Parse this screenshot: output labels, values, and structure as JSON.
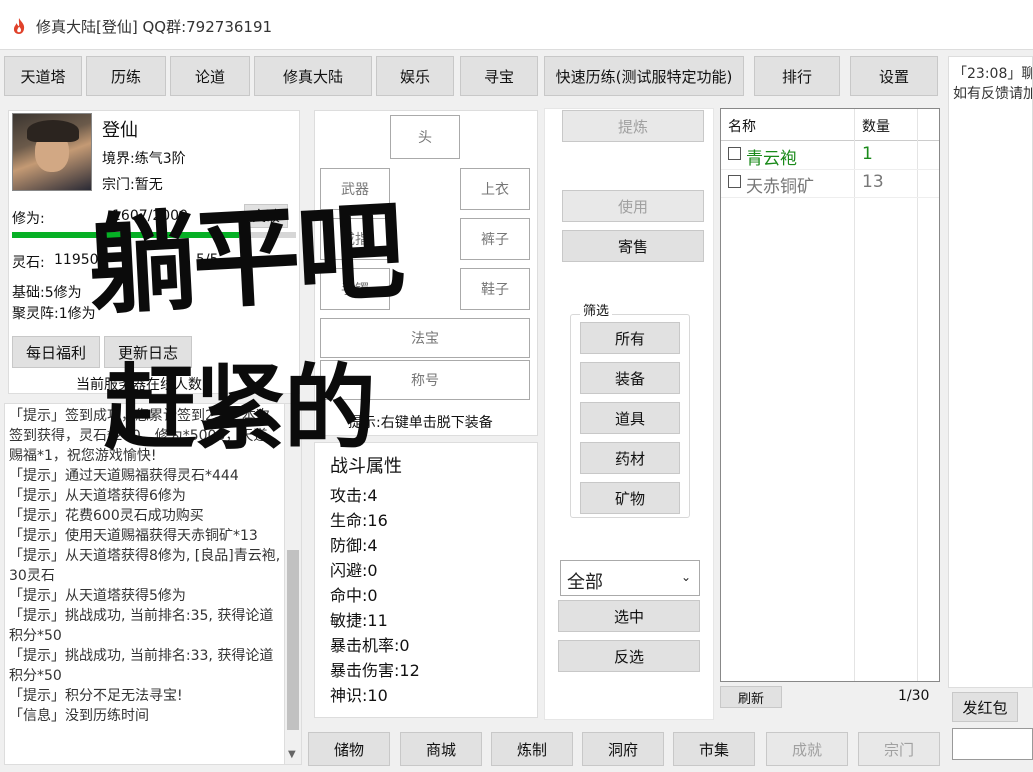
{
  "window": {
    "title": "修真大陆[登仙]  QQ群:792736191"
  },
  "menu": [
    {
      "label": "天道塔"
    },
    {
      "label": "历练"
    },
    {
      "label": "论道"
    },
    {
      "label": "修真大陆"
    },
    {
      "label": "娱乐"
    },
    {
      "label": "寻宝"
    },
    {
      "label": "快速历练(测试服特定功能)"
    },
    {
      "label": "排行"
    },
    {
      "label": "设置"
    }
  ],
  "profile": {
    "name": "登仙",
    "realm": "境界:练气3阶",
    "sect": "宗门:暂无",
    "cultivation_label": "修为:",
    "cultivation_value": "1607/2000",
    "breakthrough": "突破",
    "spirit_stone": "灵石:",
    "spirit_stone_value": "11950",
    "spirit_stone_rate": "5/5",
    "base": "基础:5修为",
    "gathering_array": "聚灵阵:1修为",
    "daily_bonus": "每日福利",
    "changelog": "更新日志",
    "online_label": "当前服务器在线人数:"
  },
  "equipment": {
    "head": "头",
    "weapon": "武器",
    "top": "上衣",
    "ring": "戒指",
    "pants": "裤子",
    "bracelet": "手镯",
    "shoes": "鞋子",
    "artifact": "法宝",
    "title": "称号",
    "hint": "提示:右键单击脱下装备"
  },
  "battle": {
    "heading": "战斗属性",
    "stats": [
      "攻击:4",
      "生命:16",
      "防御:4",
      "闪避:0",
      "命中:0",
      "敏捷:11",
      "暴击机率:0",
      "暴击伤害:12",
      "神识:10"
    ]
  },
  "actions": {
    "refine": "提炼",
    "use": "使用",
    "consign": "寄售",
    "filter_title": "筛选",
    "filters": [
      "所有",
      "装备",
      "道具",
      "药材",
      "矿物"
    ],
    "dropdown_value": "全部",
    "select": "选中",
    "invert": "反选"
  },
  "inventory": {
    "col_name": "名称",
    "col_qty": "数量",
    "rows": [
      {
        "name": "青云袍",
        "qty": "1",
        "color": "#1a8a1a"
      },
      {
        "name": "天赤铜矿",
        "qty": "13",
        "color": "#777777"
      }
    ],
    "refresh": "刷新",
    "page": "1/30"
  },
  "log": [
    "「提示」签到成功，您累计签到2天，本次签到获得，灵石*200，修为*5000，天道赐福*1，祝您游戏愉快!",
    "「提示」通过天道赐福获得灵石*444",
    "「提示」从天道塔获得6修为",
    "「提示」花费600灵石成功购买",
    "「提示」使用天道赐福获得天赤铜矿*13",
    "「提示」从天道塔获得8修为, [良品]青云袍, 30灵石",
    "「提示」从天道塔获得5修为",
    "「提示」挑战成功, 当前排名:35, 获得论道积分*50",
    "「提示」挑战成功, 当前排名:33, 获得论道积分*50",
    "「提示」积分不足无法寻宝!",
    "「信息」没到历练时间"
  ],
  "chat": {
    "line1": "「23:08」聊",
    "line2": "如有反馈请加",
    "red_packet": "发红包"
  },
  "bottom": [
    {
      "label": "储物",
      "disabled": false
    },
    {
      "label": "商城",
      "disabled": false
    },
    {
      "label": "炼制",
      "disabled": false
    },
    {
      "label": "洞府",
      "disabled": false
    },
    {
      "label": "市集",
      "disabled": false
    },
    {
      "label": "成就",
      "disabled": true
    },
    {
      "label": "宗门",
      "disabled": true
    }
  ],
  "overlay": {
    "line1": "躺平吧",
    "line2": "赶紧的"
  },
  "colors": {
    "accent_red": "#e0422b",
    "item_green": "#1a8a1a",
    "disabled_text": "#a0a0a0"
  }
}
